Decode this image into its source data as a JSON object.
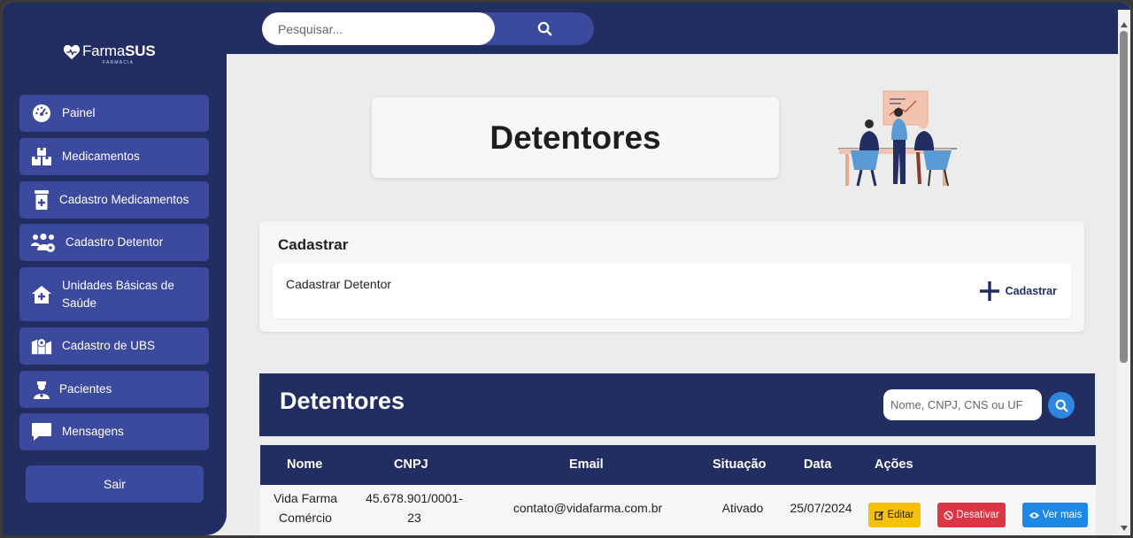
{
  "brand": {
    "name_light": "Farma",
    "name_bold": "SUS",
    "subtitle": "FARMÁCIA"
  },
  "sidebar": {
    "items": [
      {
        "label": "Painel",
        "icon": "gauge-icon"
      },
      {
        "label": "Medicamentos",
        "icon": "boxes-icon"
      },
      {
        "label": "Cadastro Medicamentos",
        "icon": "prescription-bottle-icon"
      },
      {
        "label": "Cadastro Detentor",
        "icon": "users-gear-icon"
      },
      {
        "label": "Unidades Básicas de Saúde",
        "icon": "house-medical-icon"
      },
      {
        "label": "Cadastro de UBS",
        "icon": "map-location-icon"
      },
      {
        "label": "Pacientes",
        "icon": "user-nurse-icon"
      },
      {
        "label": "Mensagens",
        "icon": "message-icon"
      }
    ],
    "logout_label": "Sair"
  },
  "topbar": {
    "search_placeholder": "Pesquisar..."
  },
  "page": {
    "title": "Detentores"
  },
  "cadastrar": {
    "heading": "Cadastrar",
    "label": "Cadastrar Detentor",
    "button_label": "Cadastrar"
  },
  "list": {
    "heading": "Detentores",
    "search_placeholder": "Nome, CNPJ, CNS ou UF",
    "columns": [
      "Nome",
      "CNPJ",
      "Email",
      "Situação",
      "Data",
      "Ações"
    ],
    "rows": [
      {
        "nome_line1": "Vida Farma",
        "nome_line2": "Comércio",
        "cnpj_line1": "45.678.901/0001-",
        "cnpj_line2": "23",
        "email": "contato@vidafarma.com.br",
        "situacao": "Ativado",
        "data": "25/07/2024",
        "actions": {
          "edit": "Editar",
          "deactivate": "Desativar",
          "view": "Ver mais"
        }
      }
    ]
  },
  "colors": {
    "navy": "#222d62",
    "nav_item": "#3c4a9e",
    "edit": "#f7c10a",
    "deactivate": "#dc3545",
    "view": "#1e88e5"
  }
}
